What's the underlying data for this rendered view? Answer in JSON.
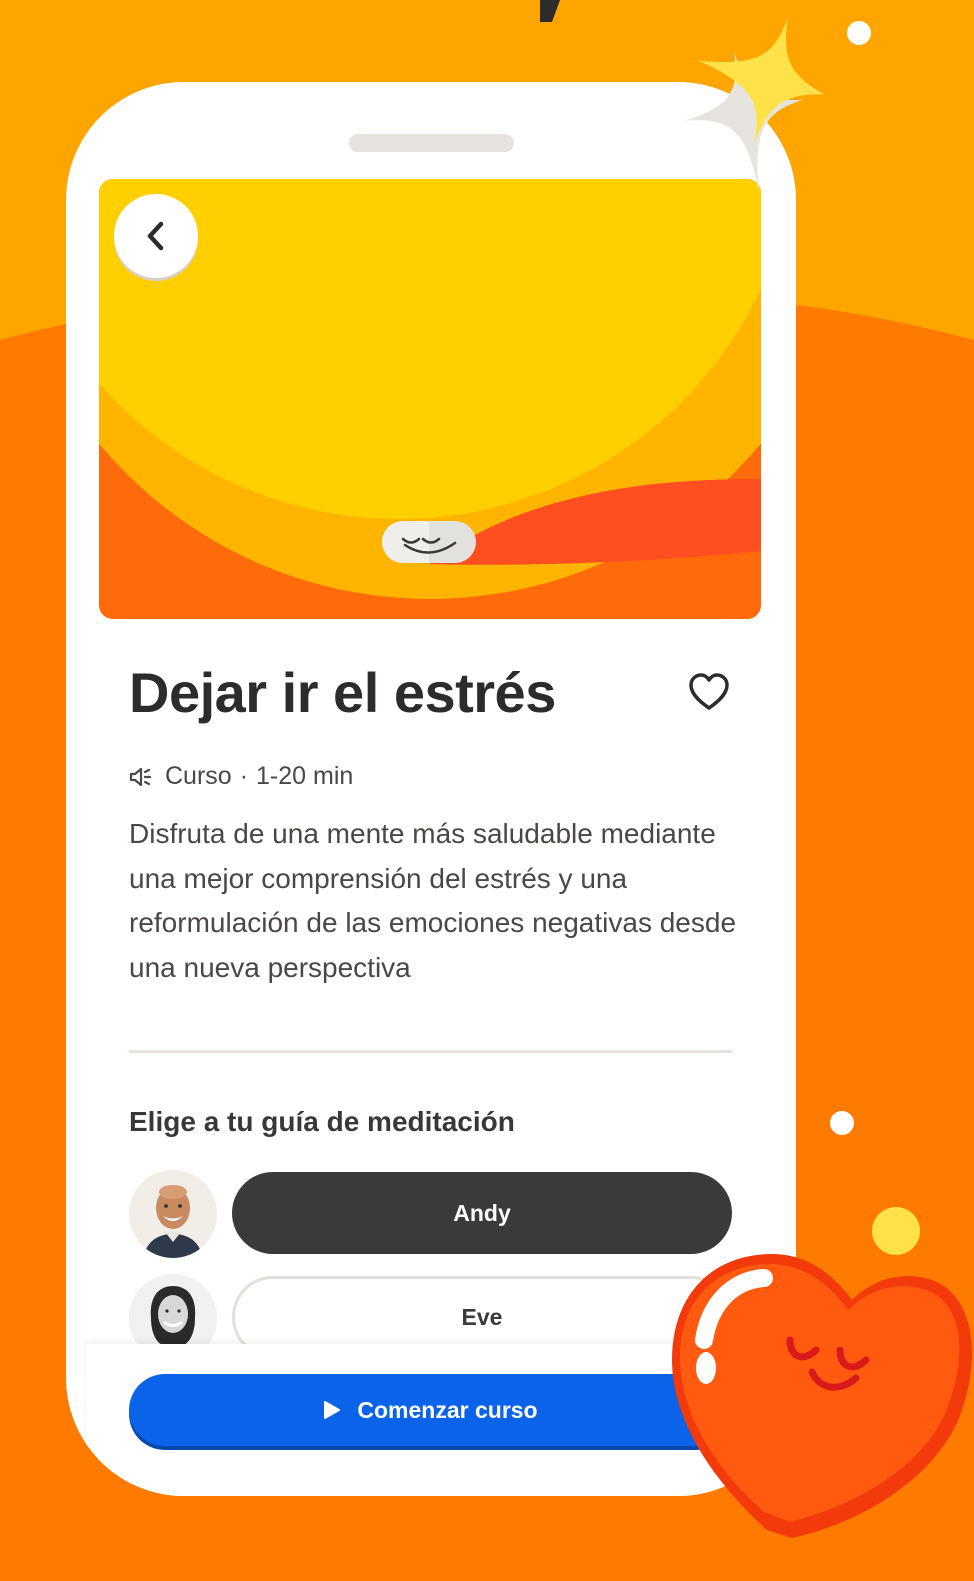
{
  "course": {
    "title": "Dejar ir el estrés",
    "type_label": "Curso",
    "separator": "·",
    "duration": "1-20 min",
    "description": "Disfruta de una mente más saludable mediante una mejor comprensión del estrés y una reformulación de las emociones negativas desde una nueva perspectiva"
  },
  "guides": {
    "heading": "Elige a tu guía de meditación",
    "options": [
      {
        "name": "Andy",
        "selected": true
      },
      {
        "name": "Eve",
        "selected": false
      }
    ]
  },
  "cta": {
    "label": "Comenzar curso"
  },
  "colors": {
    "background_orange": "#FF8A00",
    "cta_blue": "#0A63E8",
    "selected_guide": "#3B3A39",
    "hero_yellow": "#FFCF00",
    "hero_orange": "#FF6A0A"
  },
  "icons": [
    "back-chevron-icon",
    "heart-outline-icon",
    "speaker-icon",
    "play-icon",
    "sparkle-icon",
    "heart-character-icon",
    "headspace-smile-icon"
  ]
}
